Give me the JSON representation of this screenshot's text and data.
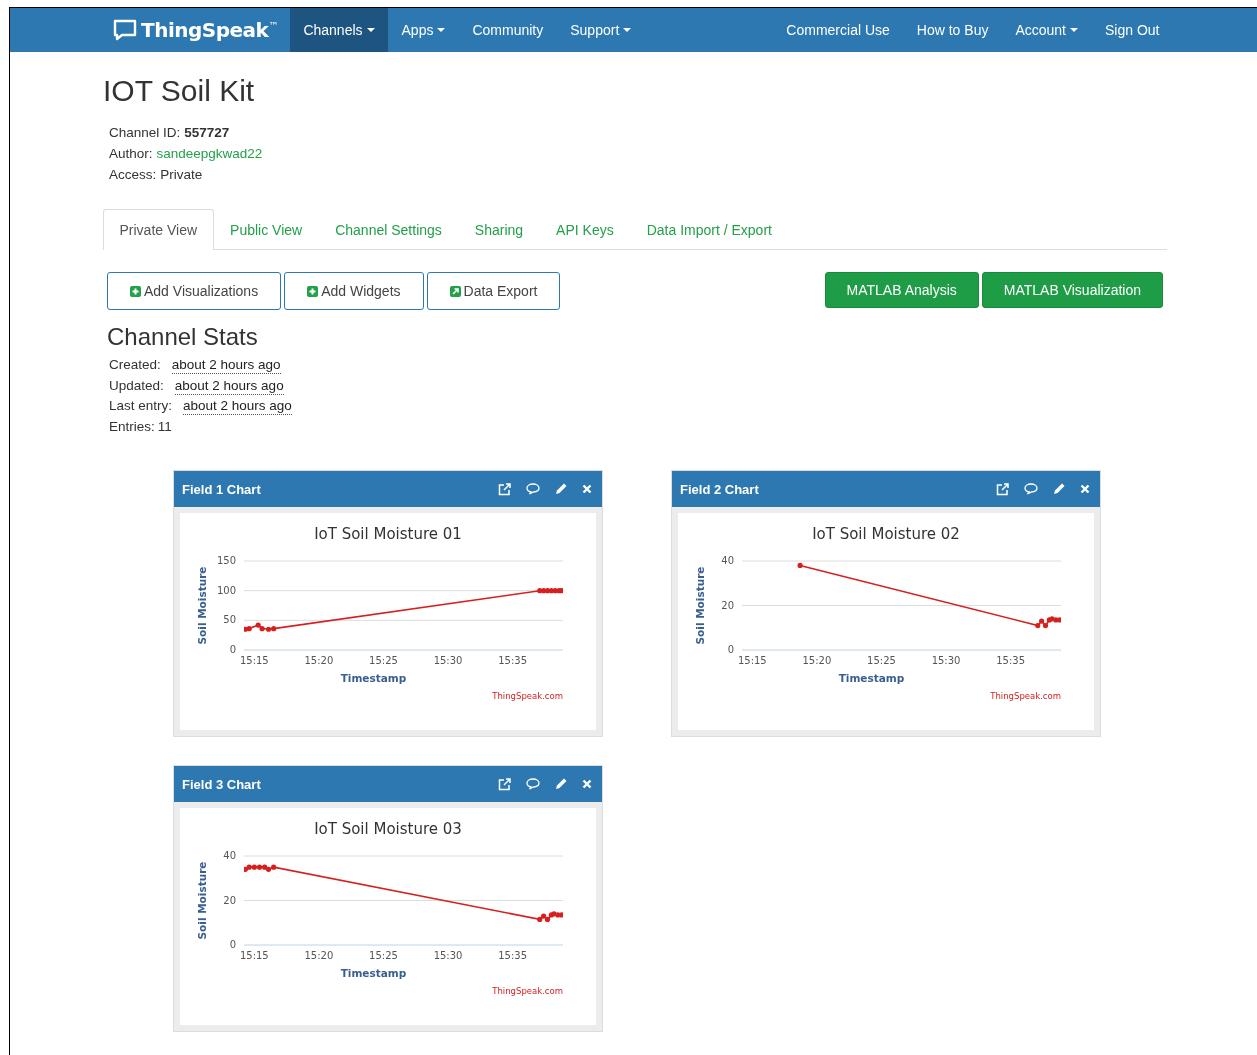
{
  "navbar": {
    "logo": "ThingSpeak",
    "logo_mark": "™",
    "left": [
      {
        "label": "Channels",
        "dropdown": true,
        "selected": true
      },
      {
        "label": "Apps",
        "dropdown": true,
        "selected": false
      },
      {
        "label": "Community",
        "dropdown": false,
        "selected": false
      },
      {
        "label": "Support",
        "dropdown": true,
        "selected": false
      }
    ],
    "right": [
      {
        "label": "Commercial Use",
        "dropdown": false,
        "selected": false
      },
      {
        "label": "How to Buy",
        "dropdown": false,
        "selected": false
      },
      {
        "label": "Account",
        "dropdown": true,
        "selected": false
      },
      {
        "label": "Sign Out",
        "dropdown": false,
        "selected": false
      }
    ]
  },
  "channel": {
    "title": "IOT Soil Kit",
    "info": [
      {
        "label": "Channel ID:",
        "value": "557727",
        "kind": "bold"
      },
      {
        "label": "Author:",
        "value": "sandeepgkwad22",
        "kind": "link"
      },
      {
        "label": "Access:",
        "value": "Private",
        "kind": "plain"
      }
    ]
  },
  "tabs": [
    {
      "label": "Private View",
      "selected": true
    },
    {
      "label": "Public View",
      "selected": false
    },
    {
      "label": "Channel Settings",
      "selected": false
    },
    {
      "label": "Sharing",
      "selected": false
    },
    {
      "label": "API Keys",
      "selected": false
    },
    {
      "label": "Data Import / Export",
      "selected": false
    }
  ],
  "action_buttons": [
    {
      "label": "Add Visualizations",
      "kind": "add"
    },
    {
      "label": "Add Widgets",
      "kind": "add"
    },
    {
      "label": "Data Export",
      "kind": "export"
    }
  ],
  "matlab_buttons": [
    "MATLAB Analysis",
    "MATLAB Visualization"
  ],
  "stats": {
    "title": "Channel Stats",
    "rows": [
      {
        "label": "Created:",
        "value": "about 2 hours ago",
        "kind": "time"
      },
      {
        "label": "Updated:",
        "value": "about 2 hours ago",
        "kind": "time"
      },
      {
        "label": "Last entry:",
        "value": "about 2 hours ago",
        "kind": "time"
      },
      {
        "label": "Entries:",
        "value": "11",
        "kind": "count"
      }
    ]
  },
  "charts": [
    {
      "header": "Field 1 Chart",
      "credit": "ThingSpeak.com",
      "chart_data": {
        "type": "line",
        "title": "IoT Soil Moisture 01",
        "xlabel": "Timestamp",
        "ylabel": "Soil Moisture",
        "xlim": [
          914.2,
          938.9
        ],
        "ylim": [
          0,
          150
        ],
        "x": [
          914.3,
          914.6,
          915.3,
          915.6,
          916.1,
          916.5,
          937.1,
          937.4,
          937.7,
          938.0,
          938.3,
          938.6,
          938.8
        ],
        "series": [
          {
            "color": "#d62020",
            "values": [
              35,
              36,
              42,
              36,
              35,
              36,
              100,
              100,
              100,
              100,
              100,
              100,
              100
            ]
          }
        ],
        "xticks": [
          {
            "value": 915,
            "label": "15:15"
          },
          {
            "value": 920,
            "label": "15:20"
          },
          {
            "value": 925,
            "label": "15:25"
          },
          {
            "value": 930,
            "label": "15:30"
          },
          {
            "value": 935,
            "label": "15:35"
          }
        ],
        "yticks": [
          0,
          50,
          100,
          150
        ]
      }
    },
    {
      "header": "Field 2 Chart",
      "credit": "ThingSpeak.com",
      "chart_data": {
        "type": "line",
        "title": "IoT Soil Moisture 02",
        "xlabel": "Timestamp",
        "ylabel": "Soil Moisture",
        "xlim": [
          914.2,
          938.9
        ],
        "ylim": [
          0,
          40
        ],
        "x": [
          918.7,
          937.1,
          937.4,
          937.7,
          938.0,
          938.2,
          938.5,
          938.8
        ],
        "series": [
          {
            "color": "#d62020",
            "values": [
              38,
              11,
              13,
              11,
              13.5,
              14,
              13.5,
              13.5
            ]
          }
        ],
        "xticks": [
          {
            "value": 915,
            "label": "15:15"
          },
          {
            "value": 920,
            "label": "15:20"
          },
          {
            "value": 925,
            "label": "15:25"
          },
          {
            "value": 930,
            "label": "15:30"
          },
          {
            "value": 935,
            "label": "15:35"
          }
        ],
        "yticks": [
          0,
          20,
          40
        ]
      }
    },
    {
      "header": "Field 3 Chart",
      "credit": "ThingSpeak.com",
      "chart_data": {
        "type": "line",
        "title": "IoT Soil Moisture 03",
        "xlabel": "Timestamp",
        "ylabel": "Soil Moisture",
        "xlim": [
          914.2,
          938.9
        ],
        "ylim": [
          0,
          40
        ],
        "x": [
          914.3,
          914.6,
          915.0,
          915.4,
          915.8,
          916.1,
          916.5,
          937.1,
          937.4,
          937.7,
          938.0,
          938.2,
          938.5,
          938.8
        ],
        "series": [
          {
            "color": "#d62020",
            "values": [
              34,
              35,
              35,
              35,
              35,
              34,
              35,
              11.5,
              13,
              11.5,
              13.5,
              14,
              13.5,
              13.5
            ]
          }
        ],
        "xticks": [
          {
            "value": 915,
            "label": "15:15"
          },
          {
            "value": 920,
            "label": "15:20"
          },
          {
            "value": 925,
            "label": "15:25"
          },
          {
            "value": 930,
            "label": "15:30"
          },
          {
            "value": 935,
            "label": "15:35"
          }
        ],
        "yticks": [
          0,
          20,
          40
        ]
      }
    }
  ]
}
